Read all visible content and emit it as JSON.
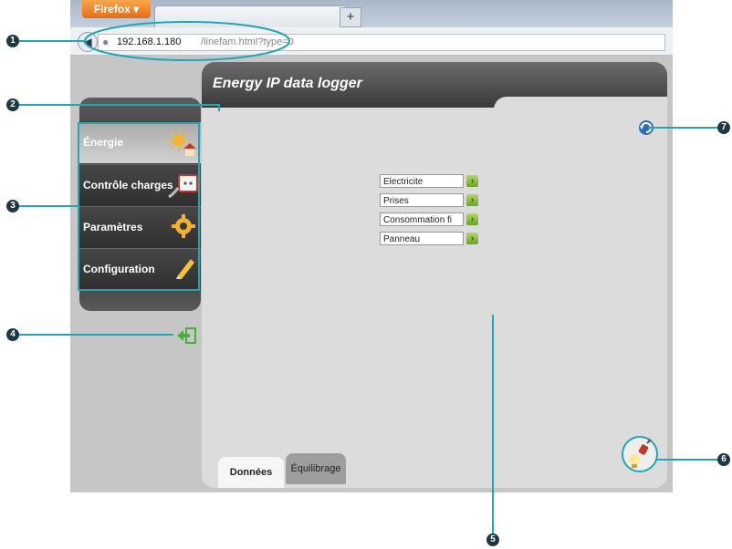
{
  "browser": {
    "menu_button": "Firefox",
    "new_tab_symbol": "+",
    "url_host": "192.168.1.180",
    "url_path": "/linefam.html?type=0"
  },
  "app": {
    "title": "Energy IP data logger",
    "menu": [
      {
        "label": "Énergie",
        "icon": "sun-house-icon",
        "active": true
      },
      {
        "label": "Contrôle charges",
        "icon": "plug-socket-icon",
        "active": false
      },
      {
        "label": "Paramètres",
        "icon": "gear-icon",
        "active": false
      },
      {
        "label": "Configuration",
        "icon": "pencil-icon",
        "active": false
      }
    ],
    "list_items": [
      "Electricite",
      "Prises",
      "Consommation fi",
      "Panneau"
    ],
    "tabs": [
      {
        "label": "Données",
        "active": true
      },
      {
        "label": "Équilibrage",
        "active": false
      }
    ]
  },
  "callouts": [
    "1",
    "2",
    "3",
    "4",
    "5",
    "6",
    "7"
  ],
  "colors": {
    "callout_line": "#23a5b3",
    "callout_badge": "#1e3844",
    "firefox_button": "#e8761c",
    "header_dark": "#3a3a3a"
  }
}
